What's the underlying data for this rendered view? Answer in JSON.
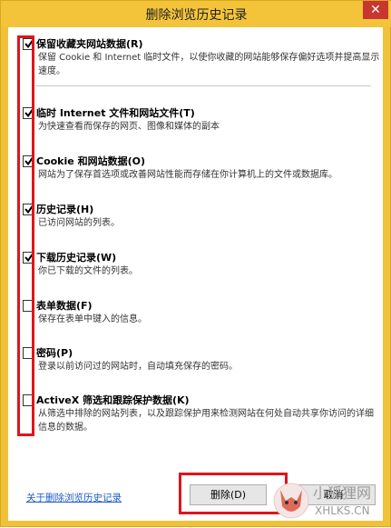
{
  "window": {
    "title": "删除浏览历史记录",
    "close_glyph": "✕"
  },
  "items": [
    {
      "label": "保留收藏夹网站数据(R)",
      "desc": "保留 Cookie 和 Internet 临时文件，以使你收藏的网站能够保存偏好选项并提高显示速度。",
      "checked": true
    },
    {
      "label": "临时 Internet 文件和网站文件(T)",
      "desc": "为快速查看而保存的网页、图像和媒体的副本",
      "checked": true
    },
    {
      "label": "Cookie 和网站数据(O)",
      "desc": "网站为了保存首选项或改善网站性能而存储在你计算机上的文件或数据库。",
      "checked": true
    },
    {
      "label": "历史记录(H)",
      "desc": "已访问网站的列表。",
      "checked": true
    },
    {
      "label": "下载历史记录(W)",
      "desc": "你已下载的文件的列表。",
      "checked": true
    },
    {
      "label": "表单数据(F)",
      "desc": "保存在表单中键入的信息。",
      "checked": false
    },
    {
      "label": "密码(P)",
      "desc": "登录以前访问过的网站时，自动填充保存的密码。",
      "checked": false
    },
    {
      "label": "ActiveX 筛选和跟踪保护数据(K)",
      "desc": "从筛选中排除的网站列表，以及跟踪保护用来检测网站在何处自动共享你访问的详细信息的数据。",
      "checked": false
    }
  ],
  "footer": {
    "link": "关于删除浏览历史记录",
    "delete_button": "删除(D)",
    "cancel_button": "取消"
  },
  "watermark": {
    "text": "小狐狸网",
    "sub": "XHLKS.CN"
  },
  "colors": {
    "frame": "#f0c239",
    "close": "#c7372f",
    "highlight": "#e0151b",
    "link": "#1a5bc8"
  }
}
